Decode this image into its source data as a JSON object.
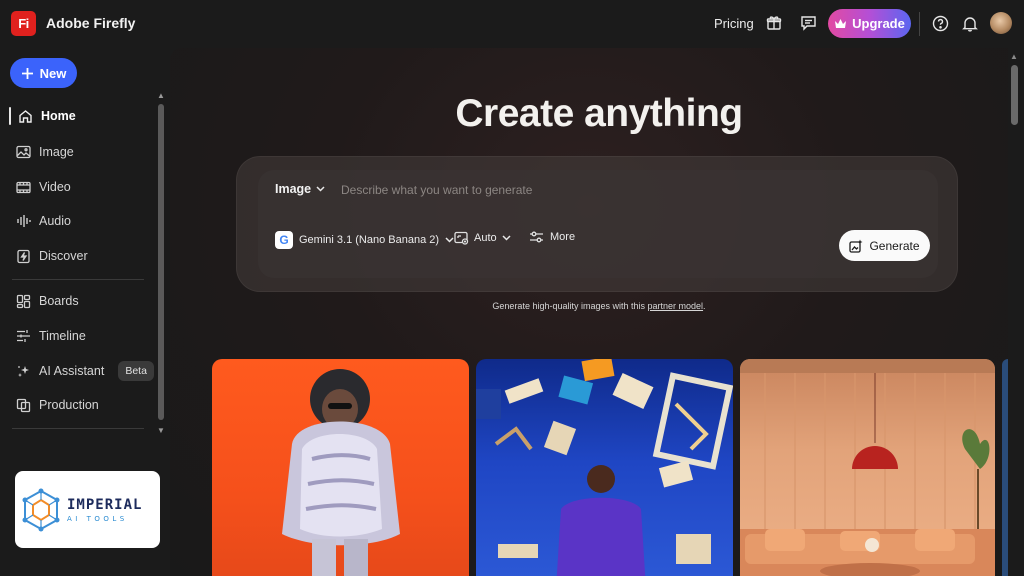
{
  "app": {
    "logo_text": "Fi",
    "title": "Adobe Firefly"
  },
  "topbar": {
    "pricing_label": "Pricing",
    "upgrade_label": "Upgrade",
    "icons": [
      "gift-icon",
      "feedback-icon",
      "crown-icon",
      "help-icon",
      "bell-icon",
      "avatar"
    ]
  },
  "sidebar": {
    "new_label": "New",
    "items": [
      {
        "label": "Home",
        "icon": "home-icon",
        "active": true
      },
      {
        "label": "Image",
        "icon": "image-icon"
      },
      {
        "label": "Video",
        "icon": "video-icon"
      },
      {
        "label": "Audio",
        "icon": "audio-icon"
      },
      {
        "label": "Discover",
        "icon": "discover-icon"
      },
      {
        "label": "Boards",
        "icon": "boards-icon"
      },
      {
        "label": "Timeline",
        "icon": "timeline-icon"
      },
      {
        "label": "AI Assistant",
        "icon": "ai-assistant-icon",
        "badge": "Beta"
      },
      {
        "label": "Production",
        "icon": "production-icon"
      }
    ],
    "promo": {
      "title": "IMPERIAL",
      "subtitle": "AI TOOLS"
    }
  },
  "main": {
    "hero_title": "Create anything",
    "prompt": {
      "mode": "Image",
      "placeholder": "Describe what you want to generate",
      "model": "Gemini 3.1 (Nano Banana 2)",
      "aspect": "Auto",
      "more_label": "More",
      "generate_label": "Generate"
    },
    "partner_note_prefix": "Generate high-quality images with this ",
    "partner_note_link": "partner model",
    "partner_note_suffix": ".",
    "tiles": [
      "tile-fashion",
      "tile-library",
      "tile-interior"
    ]
  },
  "colors": {
    "accent_blue": "#3b63fb",
    "logo_red": "#e0211e",
    "upgrade_gradient": [
      "#e24aa2",
      "#b44fd6",
      "#5b66f0"
    ]
  }
}
